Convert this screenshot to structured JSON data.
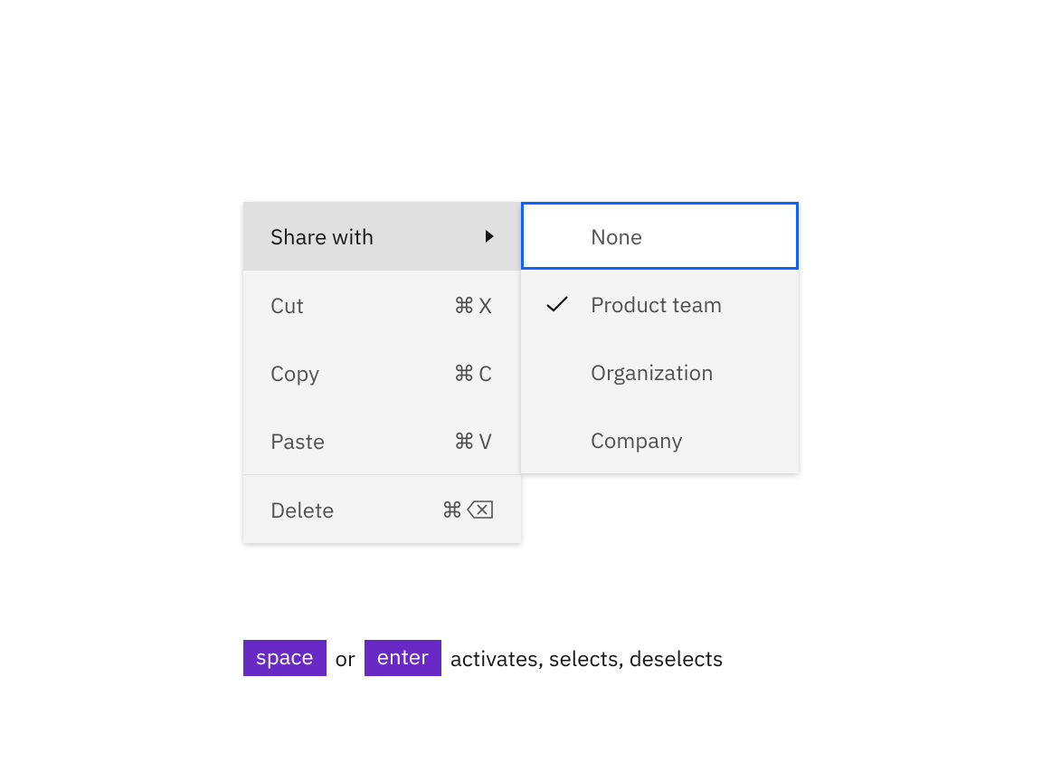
{
  "menu": {
    "root": {
      "label": "Share with"
    },
    "items": [
      {
        "label": "Cut",
        "shortcut_prefix": "⌘",
        "shortcut_key": "X"
      },
      {
        "label": "Copy",
        "shortcut_prefix": "⌘",
        "shortcut_key": "C"
      },
      {
        "label": "Paste",
        "shortcut_prefix": "⌘",
        "shortcut_key": "V"
      }
    ],
    "delete": {
      "label": "Delete",
      "shortcut_prefix": "⌘"
    }
  },
  "submenu": {
    "items": [
      {
        "label": "None",
        "selected": false,
        "focused": true
      },
      {
        "label": "Product team",
        "selected": true,
        "focused": false
      },
      {
        "label": "Organization",
        "selected": false,
        "focused": false
      },
      {
        "label": "Company",
        "selected": false,
        "focused": false
      }
    ]
  },
  "help": {
    "key1": "space",
    "join": "or",
    "key2": "enter",
    "text": "activates, selects, deselects"
  }
}
